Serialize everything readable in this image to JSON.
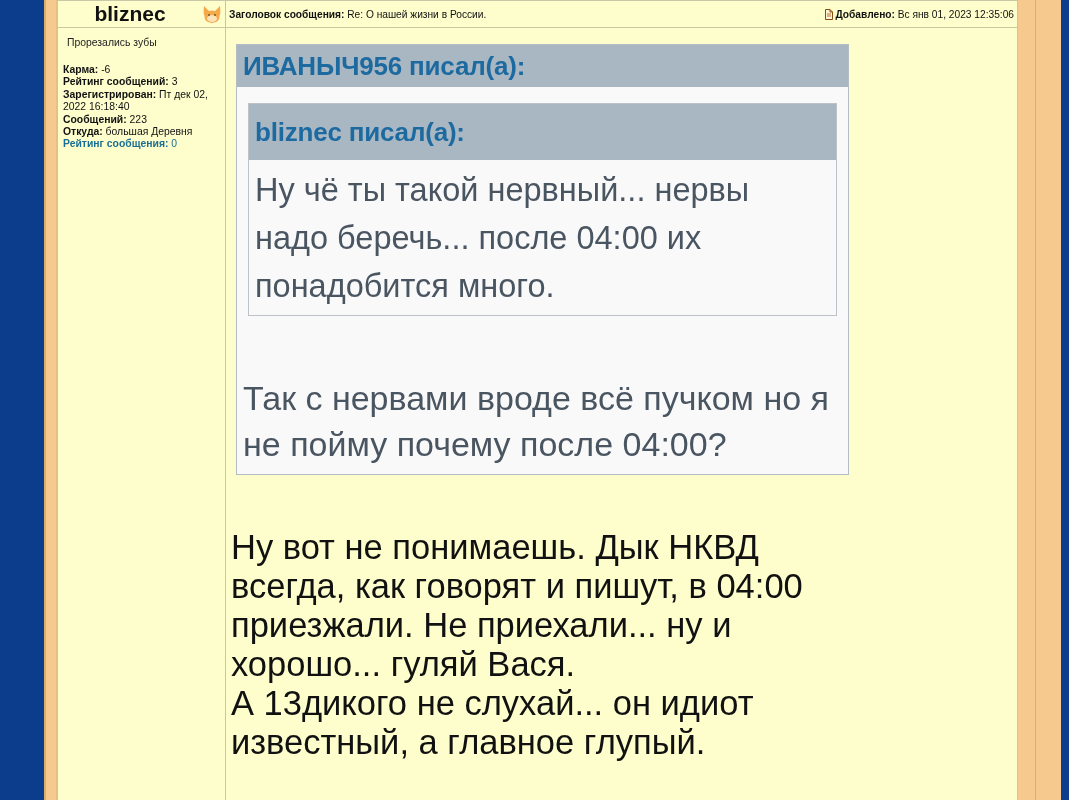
{
  "post": {
    "author": "bliznec",
    "subject": "**Заголовок сообщения:** Re: О нашей жизни в России.",
    "posted": "**Добавлено:** Вс янв 01, 2023 12:35:06",
    "rank": "Прорезались зубы",
    "profile": [
      {
        "kind": "plain",
        "text": "**Карма:** -6"
      },
      {
        "kind": "plain",
        "text": "**Рейтинг сообщений:** 3"
      },
      {
        "kind": "plain",
        "text": "**Зарегистрирован:** Пт дек 02, 2022 16:18:40"
      },
      {
        "kind": "plain",
        "text": "**Сообщений:** 223"
      },
      {
        "kind": "plain",
        "text": "**Откуда:** большая Деревня"
      },
      {
        "kind": "link",
        "text": "**Рейтинг сообщения:** 0"
      }
    ],
    "quote": {
      "header": "ИВАНЫЧ956 писал(а):",
      "quote": {
        "header": "bliznec писал(а):",
        "text": "Ну чё ты такой нервный... нервы надо беречь... после 04:00 их понадобится много."
      },
      "text": "Так с нервами вроде всё пучком но я не пойму почему после 04:00?"
    },
    "body": [
      "Ну вот не понимаешь. Дык НКВД всегда, как говорят и пишут, в 04:00 приезжали. Не приехали... ну и хорошо... гуляй Вася.",
      "А 13дикого не слухай... он идиот известный, а главное глупый."
    ]
  }
}
